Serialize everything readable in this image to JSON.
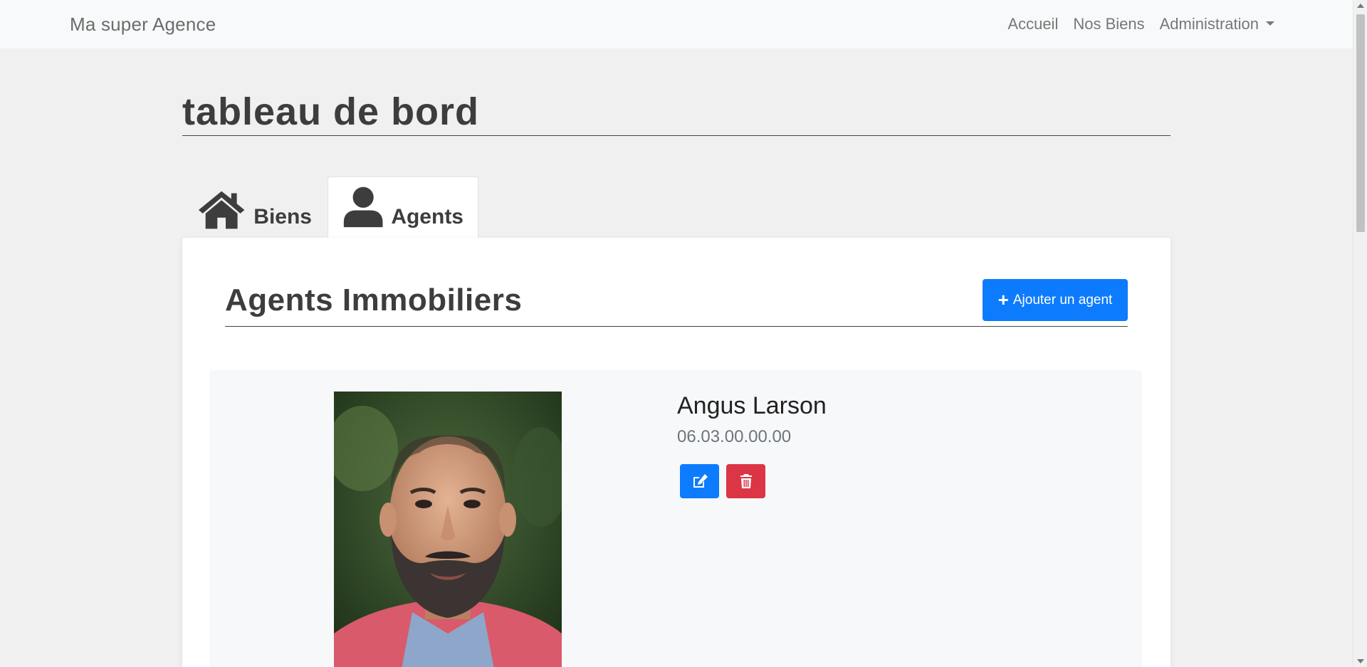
{
  "navbar": {
    "brand": "Ma super Agence",
    "links": [
      "Accueil",
      "Nos Biens",
      "Administration"
    ]
  },
  "page": {
    "title": "tableau de bord"
  },
  "tabs": [
    {
      "label": "Biens",
      "icon": "home-icon",
      "active": false
    },
    {
      "label": "Agents",
      "icon": "user-icon",
      "active": true
    }
  ],
  "panel": {
    "title": "Agents Immobiliers",
    "add_button": "Ajouter un agent"
  },
  "agents": [
    {
      "name": "Angus Larson",
      "phone": "06.03.00.00.00"
    }
  ],
  "colors": {
    "primary": "#0d7bfd",
    "danger": "#dc3545",
    "background": "#f0f0f0"
  }
}
